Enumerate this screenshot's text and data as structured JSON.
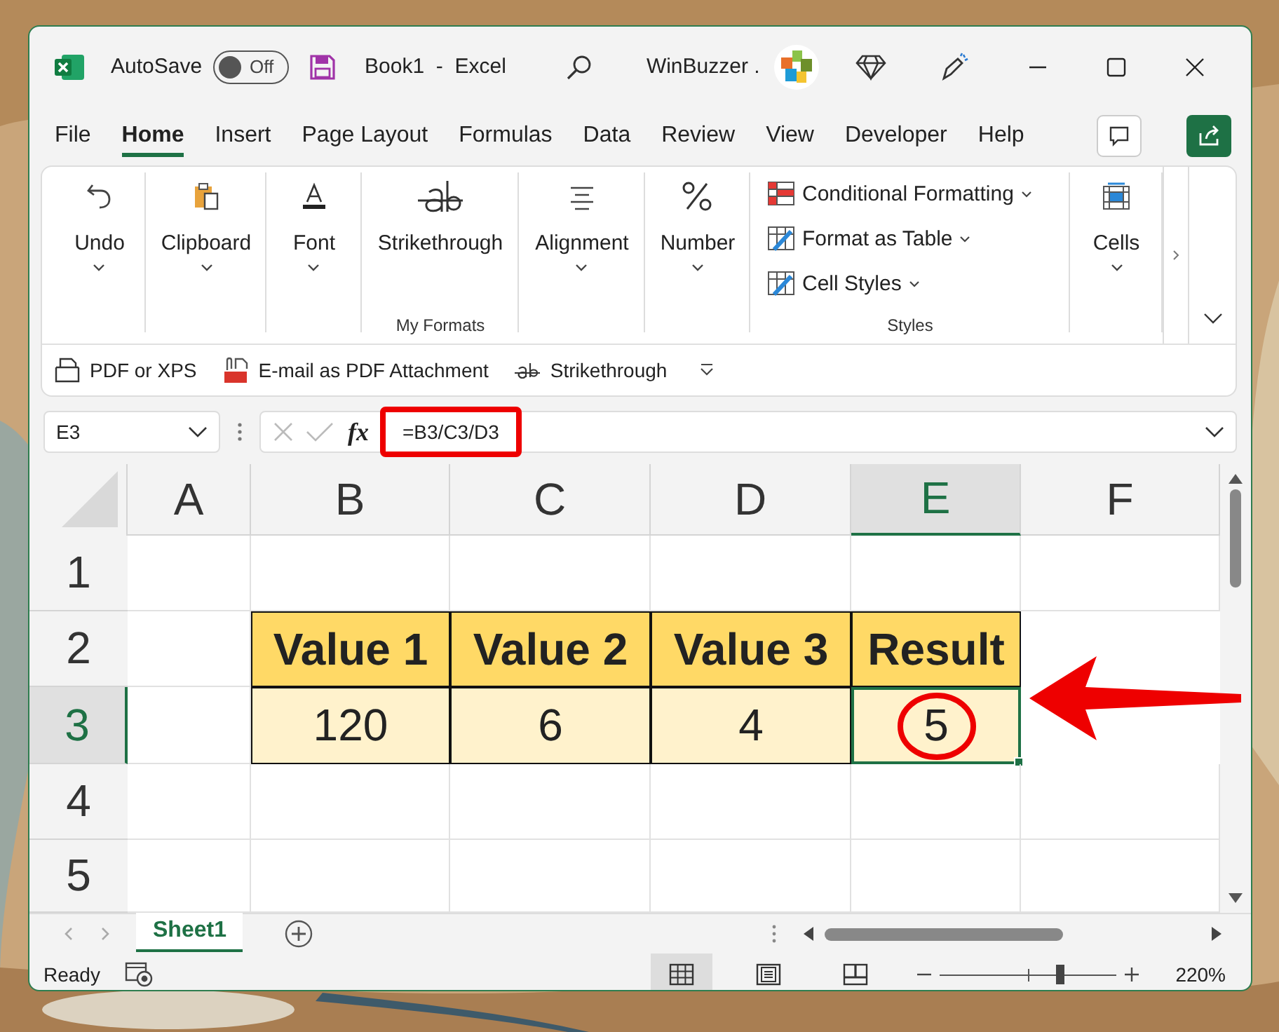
{
  "title_bar": {
    "autosave_label": "AutoSave",
    "autosave": {
      "label": "Off",
      "on": false
    },
    "document": "Book1  -  Excel",
    "account": "WinBuzzer ."
  },
  "menu_tabs": [
    {
      "label": "File",
      "selected": false
    },
    {
      "label": "Home",
      "selected": true
    },
    {
      "label": "Insert",
      "selected": false
    },
    {
      "label": "Page Layout",
      "selected": false
    },
    {
      "label": "Formulas",
      "selected": false
    },
    {
      "label": "Data",
      "selected": false
    },
    {
      "label": "Review",
      "selected": false
    },
    {
      "label": "View",
      "selected": false
    },
    {
      "label": "Developer",
      "selected": false
    },
    {
      "label": "Help",
      "selected": false
    }
  ],
  "ribbon": {
    "groups": [
      {
        "kind": "button",
        "label": "Undo"
      },
      {
        "kind": "button",
        "label": "Clipboard"
      },
      {
        "kind": "button",
        "label": "Font"
      },
      {
        "kind": "named",
        "label": "Strikethrough",
        "group": "My Formats"
      },
      {
        "kind": "button",
        "label": "Alignment"
      },
      {
        "kind": "button",
        "label": "Number"
      },
      {
        "kind": "list",
        "items": [
          "Conditional Formatting",
          "Format as Table",
          "Cell Styles"
        ],
        "group": "Styles"
      },
      {
        "kind": "button",
        "label": "Cells"
      }
    ],
    "quick_access": [
      "PDF or XPS",
      "E-mail as PDF Attachment",
      "Strikethrough"
    ]
  },
  "formula_bar": {
    "name_box": "E3",
    "function_button": "fx",
    "formula": "=B3/C3/D3",
    "highlighted": true
  },
  "sheet": {
    "columns": [
      {
        "label": "A",
        "selected": false
      },
      {
        "label": "B",
        "selected": false
      },
      {
        "label": "C",
        "selected": false
      },
      {
        "label": "D",
        "selected": false
      },
      {
        "label": "E",
        "selected": true
      },
      {
        "label": "F",
        "selected": false
      }
    ],
    "rows": [
      {
        "label": "1",
        "selected": false
      },
      {
        "label": "2",
        "selected": false
      },
      {
        "label": "3",
        "selected": true
      },
      {
        "label": "4",
        "selected": false
      },
      {
        "label": "5",
        "selected": false
      }
    ],
    "table": {
      "header": [
        "Value 1",
        "Value 2",
        "Value 3",
        "Result"
      ],
      "values": [
        {
          "text": "120",
          "selected": false,
          "circled": false
        },
        {
          "text": "6",
          "selected": false,
          "circled": false
        },
        {
          "text": "4",
          "selected": false,
          "circled": false
        },
        {
          "text": "5",
          "selected": true,
          "circled": true
        }
      ]
    },
    "pointer_arrow": true
  },
  "sheet_tabs": [
    {
      "label": "Sheet1",
      "selected": true
    }
  ],
  "status_bar": {
    "status": "Ready",
    "views": [
      {
        "selected": true
      },
      {
        "selected": false
      },
      {
        "selected": false
      }
    ],
    "zoom": {
      "level": 0.68
    },
    "zoom_label": "220%"
  }
}
